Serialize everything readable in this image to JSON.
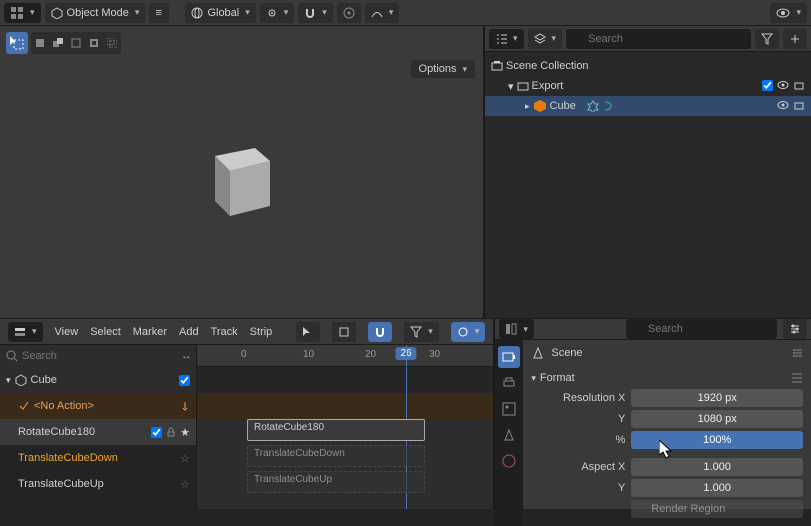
{
  "header": {
    "mode": "Object Mode",
    "orientation": "Global",
    "search_placeholder": "Search"
  },
  "viewport": {
    "options_label": "Options"
  },
  "outliner": {
    "root": "Scene Collection",
    "collection": "Export",
    "object": "Cube"
  },
  "timeline": {
    "menus": [
      "View",
      "Select",
      "Marker",
      "Add",
      "Track",
      "Strip"
    ],
    "search_placeholder": "Search",
    "object": "Cube",
    "no_action": "<No Action>",
    "tracks": [
      "RotateCube180",
      "TranslateCubeDown",
      "TranslateCubeUp"
    ],
    "ruler": [
      0,
      10,
      20,
      30
    ],
    "current_frame": 26,
    "strips": {
      "rotate": "RotateCube180",
      "down": "TranslateCubeDown",
      "up": "TranslateCubeUp"
    }
  },
  "properties": {
    "search_placeholder": "Search",
    "scene_label": "Scene",
    "format_panel": "Format",
    "fields": {
      "res_x_label": "Resolution X",
      "res_x": "1920 px",
      "res_y_label": "Y",
      "res_y": "1080 px",
      "pct_label": "%",
      "pct": "100%",
      "aspect_x_label": "Aspect X",
      "aspect_x": "1.000",
      "aspect_y_label": "Y",
      "aspect_y": "1.000",
      "render_region": "Render Region"
    }
  }
}
